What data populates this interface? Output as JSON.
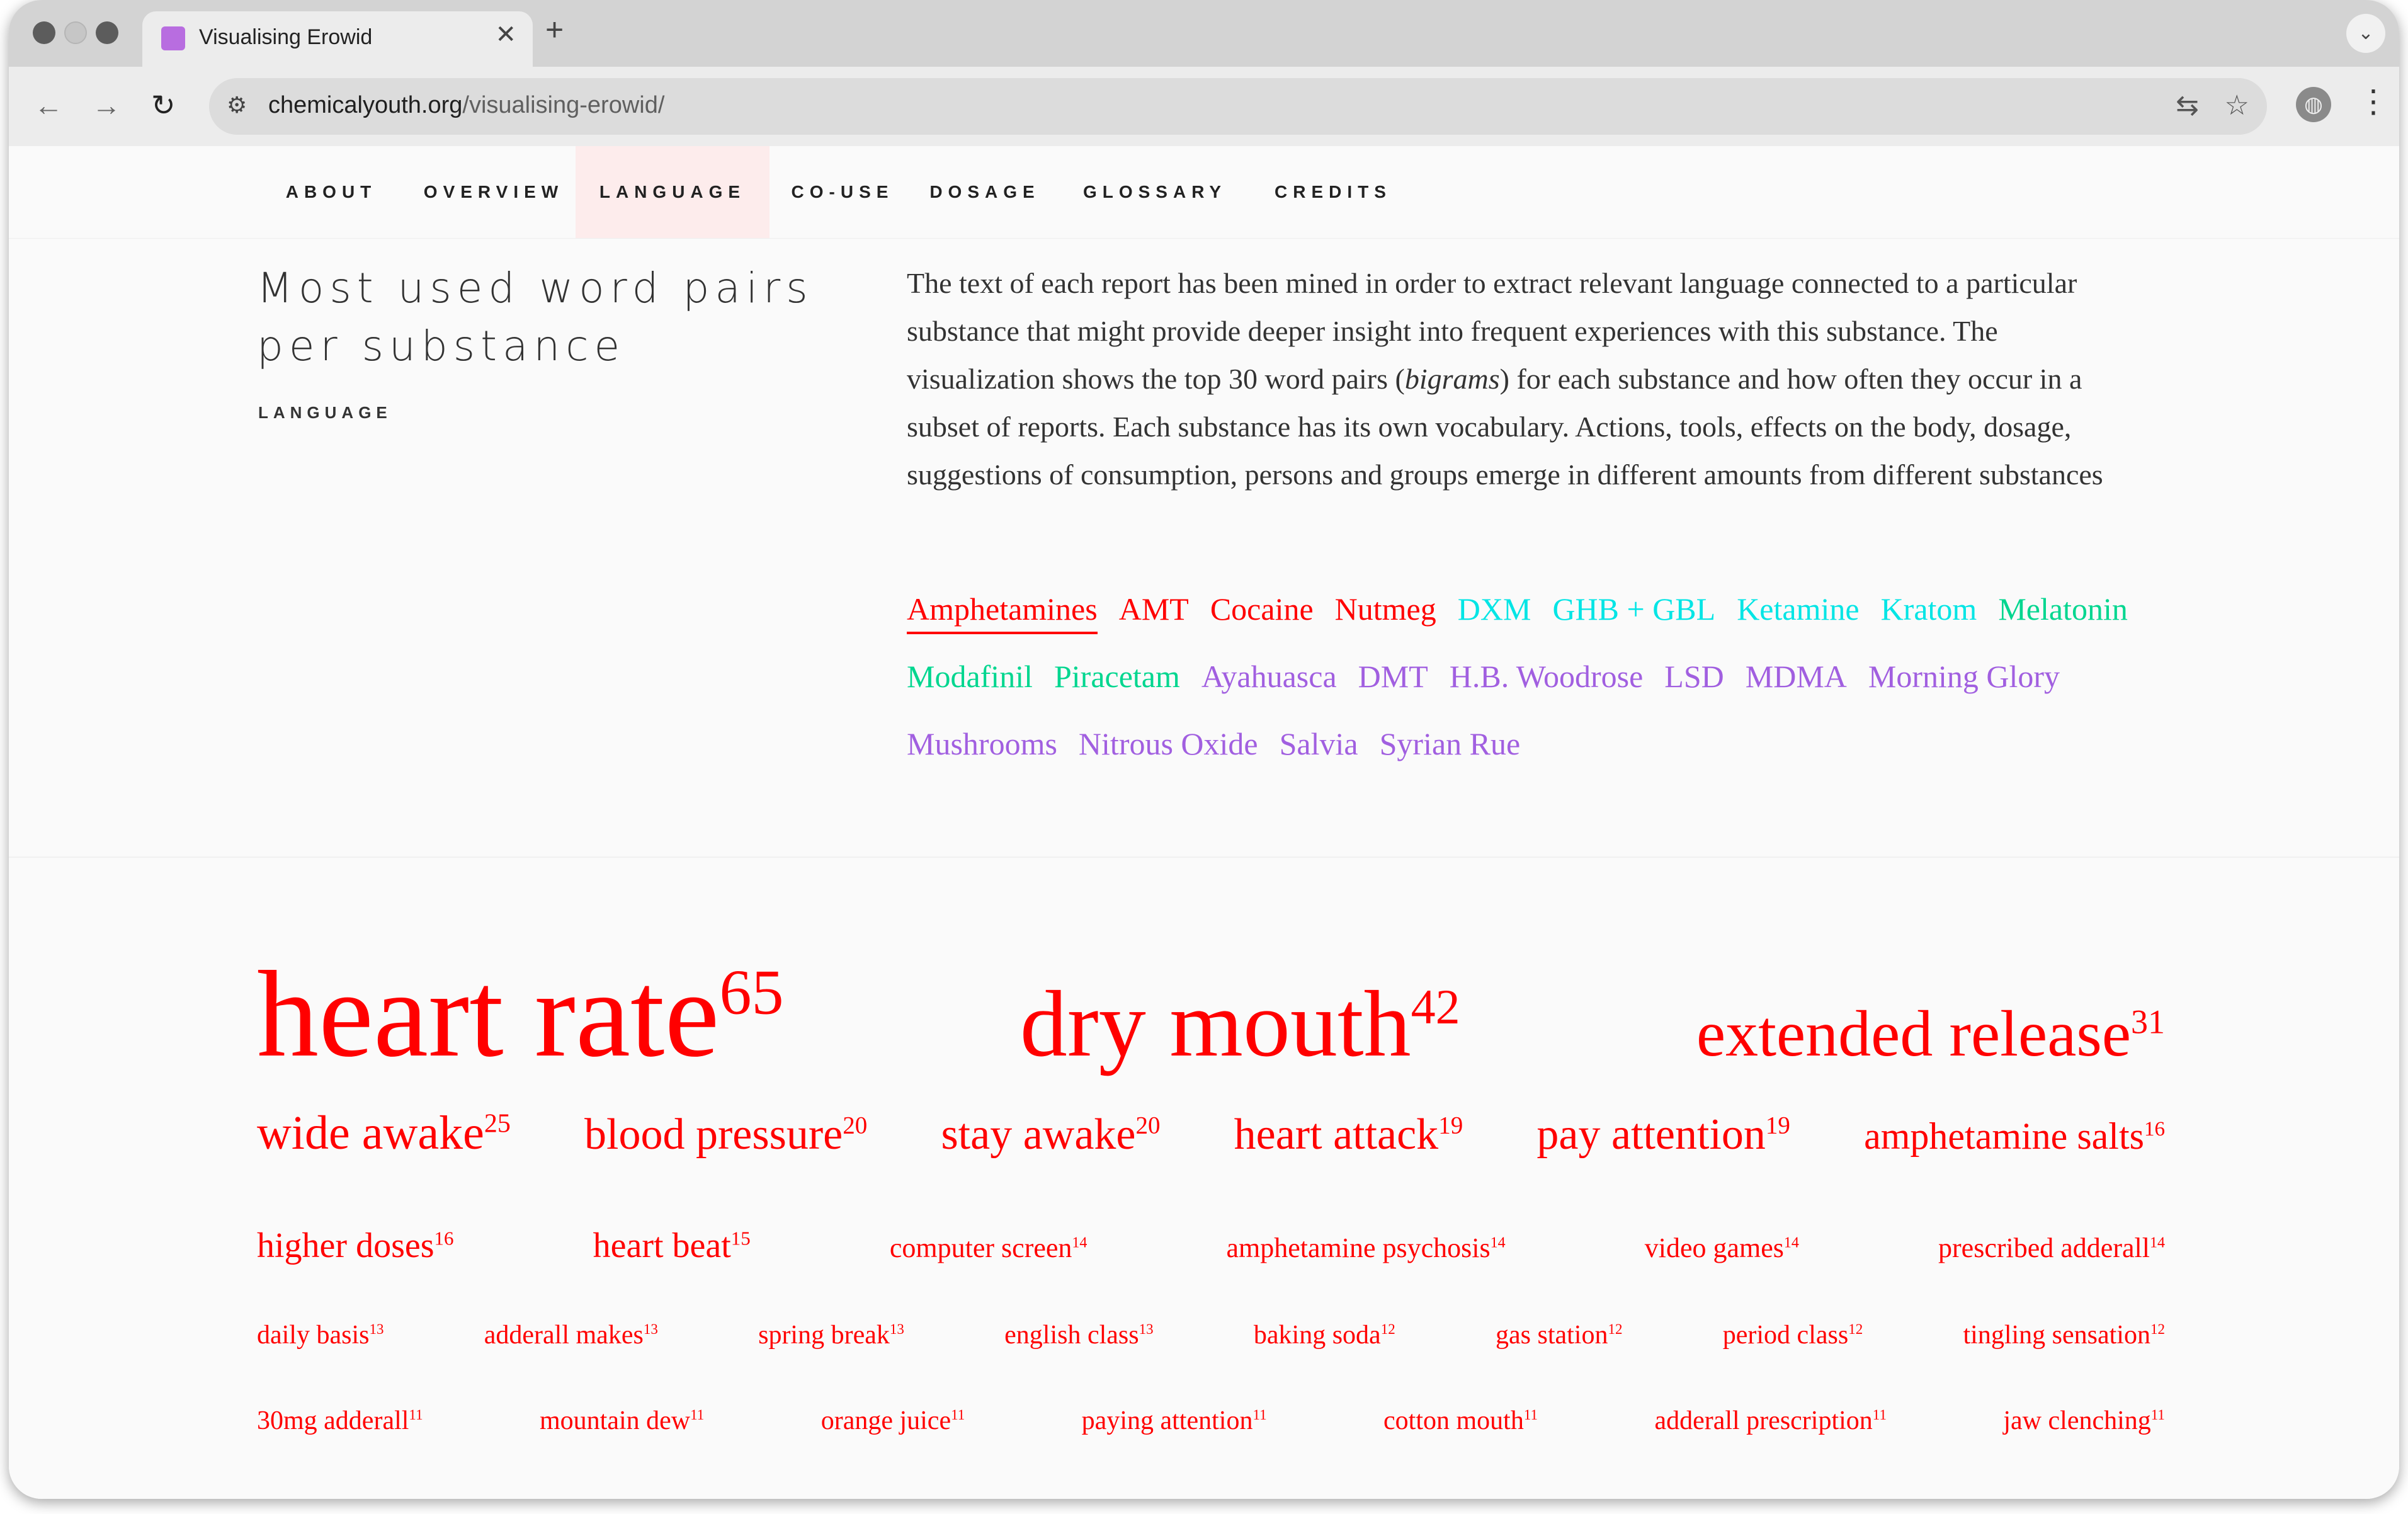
{
  "browser": {
    "tab_title": "Visualising Erowid",
    "tab_close": "✕",
    "new_tab": "+",
    "tabs_menu": "⌄",
    "url_domain": "chemicalyouth.org",
    "url_path": "/visualising-erowid/",
    "back": "←",
    "forward": "→",
    "reload": "↻",
    "site_info": "⚙",
    "translate": "⇆",
    "bookmark": "☆",
    "menu": "⋮",
    "profile": "◍"
  },
  "nav": {
    "items": [
      {
        "label": "ABOUT"
      },
      {
        "label": "OVERVIEW"
      },
      {
        "label": "LANGUAGE",
        "active": true
      },
      {
        "label": "CO-USE"
      },
      {
        "label": "DOSAGE"
      },
      {
        "label": "GLOSSARY"
      },
      {
        "label": "CREDITS"
      }
    ]
  },
  "section": {
    "title_line1": "Most used word pairs",
    "title_line2": "per substance",
    "subtitle": "LANGUAGE",
    "intro_before": "The text of each report has been mined in order to extract relevant language connected to a particular substance that might provide deeper insight into frequent experiences with this substance. The visualization shows the top 30 word pairs (",
    "intro_em": "bigrams",
    "intro_after": ") for each substance and how often they occur in a subset of reports. Each substance has its own vocabulary. Actions, tools, effects on the body, dosage, suggestions of consumption, persons and groups emerge in different amounts from different substances"
  },
  "colors": {
    "stimulant": "#ff0000",
    "dissociative": "#00e5e5",
    "nootropic": "#00d68f",
    "psychedelic": "#a15fe0",
    "word": "#ff0000"
  },
  "substances": [
    {
      "name": "Amphetamines",
      "group": "stimulant",
      "active": true
    },
    {
      "name": "AMT",
      "group": "stimulant"
    },
    {
      "name": "Cocaine",
      "group": "stimulant"
    },
    {
      "name": "Nutmeg",
      "group": "stimulant"
    },
    {
      "name": "DXM",
      "group": "dissociative"
    },
    {
      "name": "GHB + GBL",
      "group": "dissociative"
    },
    {
      "name": "Ketamine",
      "group": "dissociative"
    },
    {
      "name": "Kratom",
      "group": "dissociative"
    },
    {
      "name": "Melatonin",
      "group": "nootropic"
    },
    {
      "name": "Modafinil",
      "group": "nootropic"
    },
    {
      "name": "Piracetam",
      "group": "nootropic"
    },
    {
      "name": "Ayahuasca",
      "group": "psychedelic"
    },
    {
      "name": "DMT",
      "group": "psychedelic"
    },
    {
      "name": "H.B. Woodrose",
      "group": "psychedelic"
    },
    {
      "name": "LSD",
      "group": "psychedelic"
    },
    {
      "name": "MDMA",
      "group": "psychedelic"
    },
    {
      "name": "Morning Glory",
      "group": "psychedelic"
    },
    {
      "name": "Mushrooms",
      "group": "psychedelic"
    },
    {
      "name": "Nitrous Oxide",
      "group": "psychedelic"
    },
    {
      "name": "Salvia",
      "group": "psychedelic"
    },
    {
      "name": "Syrian Rue",
      "group": "psychedelic"
    }
  ],
  "bigrams": [
    {
      "text": "heart rate",
      "count": 65
    },
    {
      "text": "dry mouth",
      "count": 42
    },
    {
      "text": "extended release",
      "count": 31
    },
    {
      "text": "wide awake",
      "count": 25
    },
    {
      "text": "blood pressure",
      "count": 20
    },
    {
      "text": "stay awake",
      "count": 20
    },
    {
      "text": "heart attack",
      "count": 19
    },
    {
      "text": "pay attention",
      "count": 19
    },
    {
      "text": "amphetamine salts",
      "count": 16
    },
    {
      "text": "higher doses",
      "count": 16
    },
    {
      "text": "heart beat",
      "count": 15
    },
    {
      "text": "computer screen",
      "count": 14
    },
    {
      "text": "amphetamine psychosis",
      "count": 14
    },
    {
      "text": "video games",
      "count": 14
    },
    {
      "text": "prescribed adderall",
      "count": 14
    },
    {
      "text": "daily basis",
      "count": 13
    },
    {
      "text": "adderall makes",
      "count": 13
    },
    {
      "text": "spring break",
      "count": 13
    },
    {
      "text": "english class",
      "count": 13
    },
    {
      "text": "baking soda",
      "count": 12
    },
    {
      "text": "gas station",
      "count": 12
    },
    {
      "text": "period class",
      "count": 12
    },
    {
      "text": "tingling sensation",
      "count": 12
    },
    {
      "text": "30mg adderall",
      "count": 11
    },
    {
      "text": "mountain dew",
      "count": 11
    },
    {
      "text": "orange juice",
      "count": 11
    },
    {
      "text": "paying attention",
      "count": 11
    },
    {
      "text": "cotton mouth",
      "count": 11
    },
    {
      "text": "adderall prescription",
      "count": 11
    },
    {
      "text": "jaw clenching",
      "count": 11
    }
  ]
}
